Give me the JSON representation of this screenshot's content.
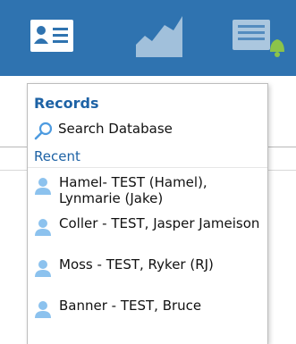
{
  "toolbar": {
    "buttons": [
      {
        "icon": "contact-card-icon"
      },
      {
        "icon": "chart-icon"
      },
      {
        "icon": "notes-bell-icon"
      }
    ],
    "colors": {
      "background": "#2f73b0",
      "icon": "#ffffff"
    }
  },
  "menu": {
    "heading": "Records",
    "search_label": "Search Database",
    "recent_heading": "Recent",
    "recent_items": [
      {
        "label": "Hamel- TEST (Hamel), Lynmarie (Jake)"
      },
      {
        "label": "Coller - TEST, Jasper Jameison"
      },
      {
        "label": "Moss - TEST, Ryker (RJ)"
      },
      {
        "label": "Banner - TEST, Bruce"
      }
    ]
  }
}
